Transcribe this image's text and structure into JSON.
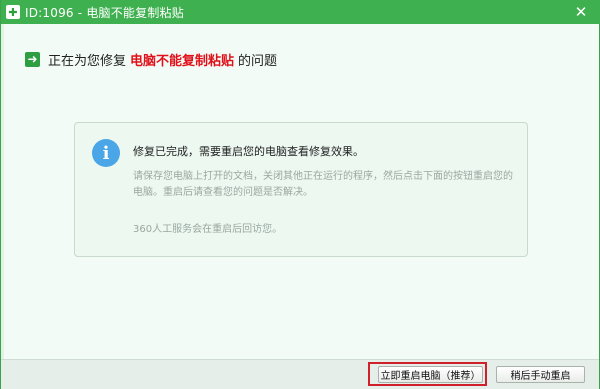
{
  "window": {
    "title": "ID:1096 - 电脑不能复制粘贴",
    "icon": "plus-icon",
    "close_label": "✕"
  },
  "heading": {
    "prefix": "正在为您修复",
    "highlight": "电脑不能复制粘贴",
    "suffix": "的问题",
    "icon": "arrow-right-icon"
  },
  "card": {
    "icon": "info-icon",
    "title": "修复已完成，需要重启您的电脑查看修复效果。",
    "body": "请保存您电脑上打开的文档，关闭其他正在运行的程序，然后点击下面的按钮重启您的电脑。重启后请查看您的问题是否解决。",
    "note": "360人工服务会在重启后回访您。"
  },
  "buttons": {
    "restart_now": "立即重启电脑（推荐）",
    "restart_later": "稍后手动重启"
  },
  "colors": {
    "titlebar": "#3fb04f",
    "highlight_text": "#e0111b",
    "annotation_box": "#d0202a"
  }
}
